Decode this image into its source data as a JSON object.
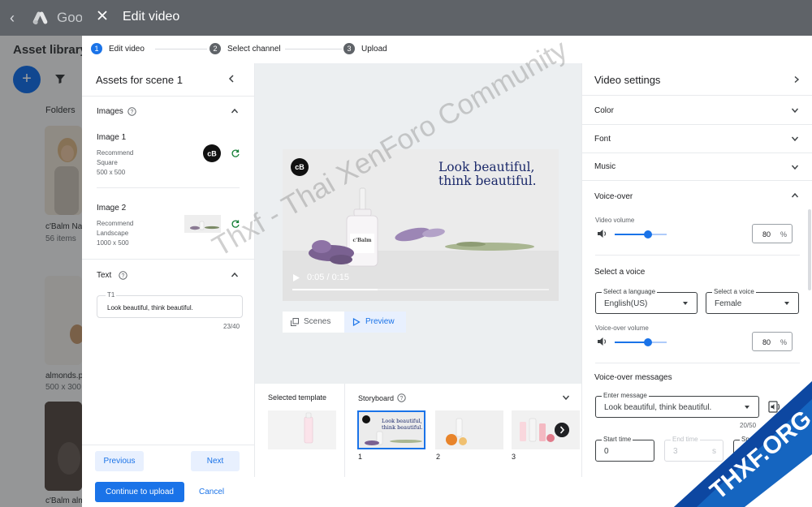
{
  "background": {
    "brand": "Goo",
    "page_title": "Asset library",
    "fab_label": "+",
    "folders_label": "Folders",
    "cards": [
      {
        "title": "c'Balm Na",
        "subtitle": "56 items"
      },
      {
        "title": "almonds.p",
        "subtitle": "500 x 300"
      },
      {
        "title": "c'Balm alm",
        "subtitle": ""
      }
    ]
  },
  "dialog": {
    "title": "Edit video",
    "steps": [
      {
        "num": "1",
        "label": "Edit video",
        "state": "active"
      },
      {
        "num": "2",
        "label": "Select channel",
        "state": "idle"
      },
      {
        "num": "3",
        "label": "Upload",
        "state": "idle"
      }
    ]
  },
  "assets": {
    "title": "Assets for scene 1",
    "images_section": "Images",
    "images": [
      {
        "name": "Image 1",
        "meta": [
          "Recommend",
          "Square",
          "500 x 500"
        ]
      },
      {
        "name": "Image 2",
        "meta": [
          "Recommend",
          "Landscape",
          "1000 x 500"
        ]
      }
    ],
    "text_section": "Text",
    "text_field_label": "T1",
    "text_field_value": "Look beautiful, think beautiful.",
    "char_count": "23/40",
    "previous_label": "Previous",
    "next_label": "Next"
  },
  "preview": {
    "headline_line1": "Look beautiful,",
    "headline_line2": "think beautiful.",
    "logo_text": "cB",
    "product_brand": "c'Balm",
    "time": "0:05 / 0:15",
    "progress_fraction": 0.333,
    "tab_scenes": "Scenes",
    "tab_preview": "Preview"
  },
  "bottom": {
    "selected_template_label": "Selected template",
    "storyboard_label": "Storyboard",
    "scene_numbers": [
      "1",
      "2",
      "3"
    ]
  },
  "settings": {
    "title": "Video settings",
    "sections": [
      "Color",
      "Font",
      "Music"
    ],
    "voiceover_title": "Voice-over",
    "video_volume_label": "Video volume",
    "video_volume": "80",
    "percent": "%",
    "select_voice_title": "Select a voice",
    "language_label": "Select a language",
    "language_value": "English(US)",
    "voice_label": "Select a voice",
    "voice_value": "Female",
    "voiceover_volume_label": "Voice-over volume",
    "voiceover_volume": "80",
    "messages_title": "Voice-over messages",
    "message_label": "Enter message",
    "message_value": "Look beautiful, think beautiful.",
    "message_count": "20/50",
    "start_time_label": "Start time",
    "start_time_value": "0",
    "end_time_label": "End time",
    "end_time_value": "3",
    "end_time_unit": "s",
    "speed_label": "Sp"
  },
  "footer": {
    "continue_label": "Continue to upload",
    "cancel_label": "Cancel"
  },
  "watermark": {
    "text": "Thxf - Thai XenForo Community",
    "corner": "THXF.ORG"
  },
  "colors": {
    "accent": "#1a73e8",
    "header_gray": "#5f6368",
    "headline_navy": "#1c2a6b",
    "corner_blue": "#1565c0"
  }
}
